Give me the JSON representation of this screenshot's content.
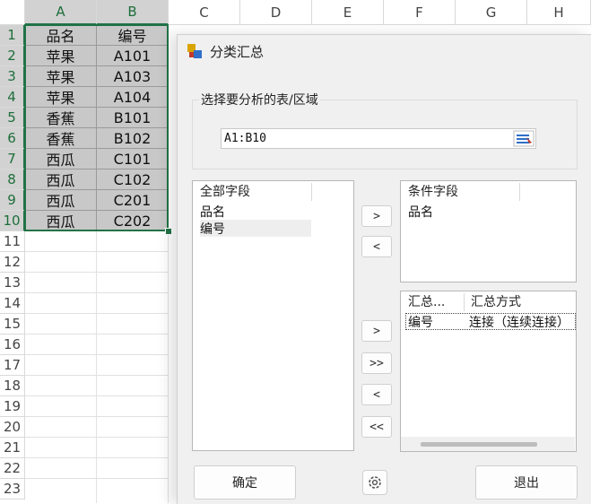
{
  "spreadsheet": {
    "columns": [
      "A",
      "B",
      "C",
      "D",
      "E",
      "F",
      "G",
      "H"
    ],
    "rows": [
      "1",
      "2",
      "3",
      "4",
      "5",
      "6",
      "7",
      "8",
      "9",
      "10",
      "11",
      "12",
      "13",
      "14",
      "15",
      "16",
      "17",
      "18",
      "19",
      "20",
      "21",
      "22",
      "23"
    ],
    "table": [
      [
        "品名",
        "编号"
      ],
      [
        "苹果",
        "A101"
      ],
      [
        "苹果",
        "A103"
      ],
      [
        "苹果",
        "A104"
      ],
      [
        "香蕉",
        "B101"
      ],
      [
        "香蕉",
        "B102"
      ],
      [
        "西瓜",
        "C101"
      ],
      [
        "西瓜",
        "C102"
      ],
      [
        "西瓜",
        "C201"
      ],
      [
        "西瓜",
        "C202"
      ]
    ]
  },
  "dialog": {
    "title": "分类汇总",
    "range_group_label": "选择要分析的表/区域",
    "range_value": "A1:B10",
    "all_fields": {
      "header": "全部字段",
      "items": [
        "品名",
        "编号"
      ]
    },
    "condition_fields": {
      "header": "条件字段",
      "items": [
        "品名"
      ]
    },
    "summary": {
      "header_field": "汇总...",
      "header_method": "汇总方式",
      "rows": [
        {
          "field": "编号",
          "method": "连接（连续连接）"
        }
      ]
    },
    "arrows": {
      "add": ">",
      "remove": "<",
      "add_all": ">>",
      "remove_all": "<<"
    },
    "ok_label": "确定",
    "exit_label": "退出"
  },
  "colors": {
    "selection": "#217346",
    "dialog_bg": "#f0f0f0",
    "cell_fill": "#c8c8c8"
  }
}
